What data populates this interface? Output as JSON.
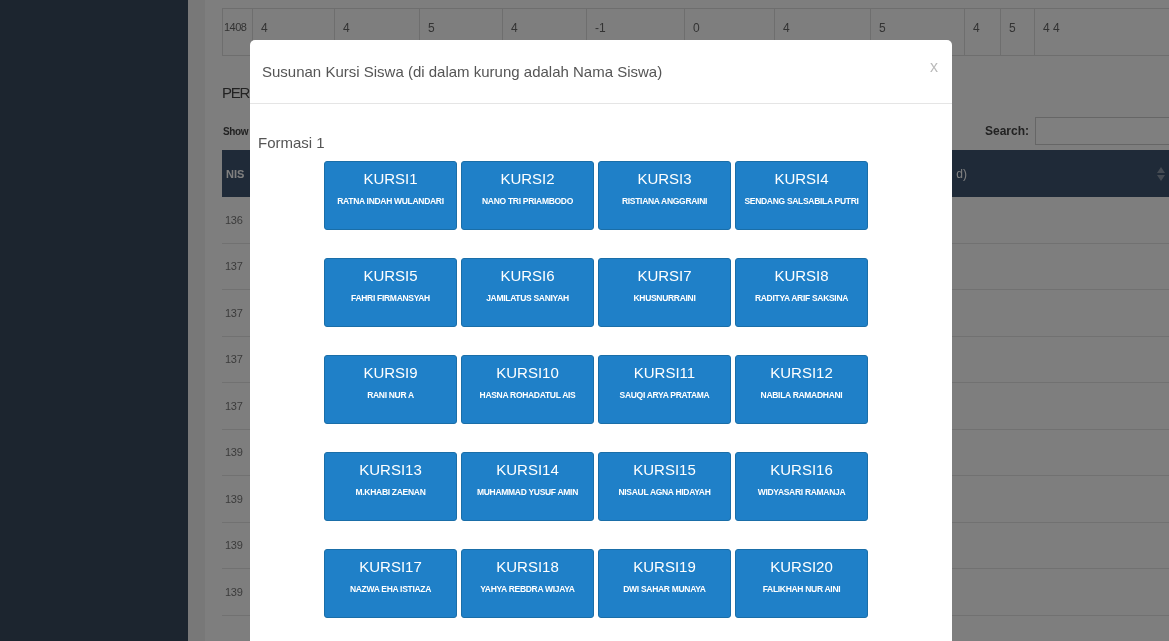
{
  "top_row": [
    "1408",
    "4",
    "4",
    "5",
    "4",
    "-1",
    "0",
    "4",
    "5",
    "4",
    "5",
    "4 4"
  ],
  "section_heading": "PER",
  "show_label": "Show",
  "search_label": "Search:",
  "table": {
    "first_header": "NIS",
    "last_header": "d)",
    "first_column": [
      "136",
      "137",
      "137",
      "137",
      "137",
      "139",
      "139",
      "139",
      "139"
    ]
  },
  "modal": {
    "title": "Susunan Kursi Siswa (di dalam kurung adalah Nama Siswa)",
    "close": "x",
    "formation": "Formasi 1",
    "seats": [
      {
        "label": "KURSI1",
        "name": "RATNA INDAH WULANDARI"
      },
      {
        "label": "KURSI2",
        "name": "NANO TRI PRIAMBODO"
      },
      {
        "label": "KURSI3",
        "name": "RISTIANA ANGGRAINI"
      },
      {
        "label": "KURSI4",
        "name": "SENDANG SALSABILA PUTRI"
      },
      {
        "label": "KURSI5",
        "name": "FAHRI FIRMANSYAH"
      },
      {
        "label": "KURSI6",
        "name": "JAMILATUS SANIYAH"
      },
      {
        "label": "KURSI7",
        "name": "KHUSNURRAINI"
      },
      {
        "label": "KURSI8",
        "name": "RADITYA ARIF SAKSINA"
      },
      {
        "label": "KURSI9",
        "name": "RANI NUR A"
      },
      {
        "label": "KURSI10",
        "name": "HASNA ROHADATUL AIS"
      },
      {
        "label": "KURSI11",
        "name": "SAUQI ARYA PRATAMA"
      },
      {
        "label": "KURSI12",
        "name": "NABILA RAMADHANI"
      },
      {
        "label": "KURSI13",
        "name": "M.KHABI ZAENAN"
      },
      {
        "label": "KURSI14",
        "name": "MUHAMMAD YUSUF AMIN"
      },
      {
        "label": "KURSI15",
        "name": "NISAUL AGNA HIDAYAH"
      },
      {
        "label": "KURSI16",
        "name": "WIDYASARI RAMANJA"
      },
      {
        "label": "KURSI17",
        "name": "NAZWA EHA ISTIAZA"
      },
      {
        "label": "KURSI18",
        "name": "YAHYA REBDRA WIJAYA"
      },
      {
        "label": "KURSI19",
        "name": "DWI SAHAR MUNAYA"
      },
      {
        "label": "KURSI20",
        "name": "FALIKHAH NUR AINI"
      }
    ]
  }
}
